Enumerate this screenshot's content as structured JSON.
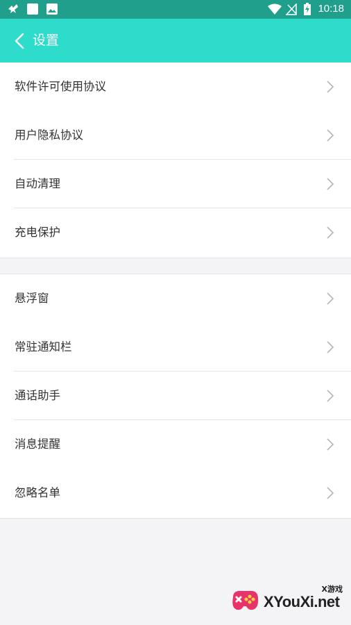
{
  "status_bar": {
    "time": "10:18",
    "icons": [
      "bird-notification-icon",
      "square-notification-icon",
      "image-notification-icon",
      "wifi-icon",
      "no-signal-icon",
      "battery-charging-icon"
    ]
  },
  "header": {
    "title": "设置",
    "back_icon": "chevron-left-icon"
  },
  "groups": [
    {
      "items": [
        {
          "label": "软件许可使用协议"
        },
        {
          "label": "用户隐私协议"
        },
        {
          "label": "自动清理"
        },
        {
          "label": "充电保护"
        }
      ]
    },
    {
      "items": [
        {
          "label": "悬浮窗"
        },
        {
          "label": "常驻通知栏"
        },
        {
          "label": "通话助手"
        },
        {
          "label": "消息提醒"
        },
        {
          "label": "忽略名单"
        }
      ]
    }
  ],
  "watermark": {
    "text": "XYouXi.net",
    "sub": "X游戏"
  },
  "colors": {
    "accent": "#2ddccb",
    "status_bar": "#1f9f8c",
    "background": "#f4f4f6",
    "text": "#333333",
    "chevron": "#b5b5b5"
  }
}
